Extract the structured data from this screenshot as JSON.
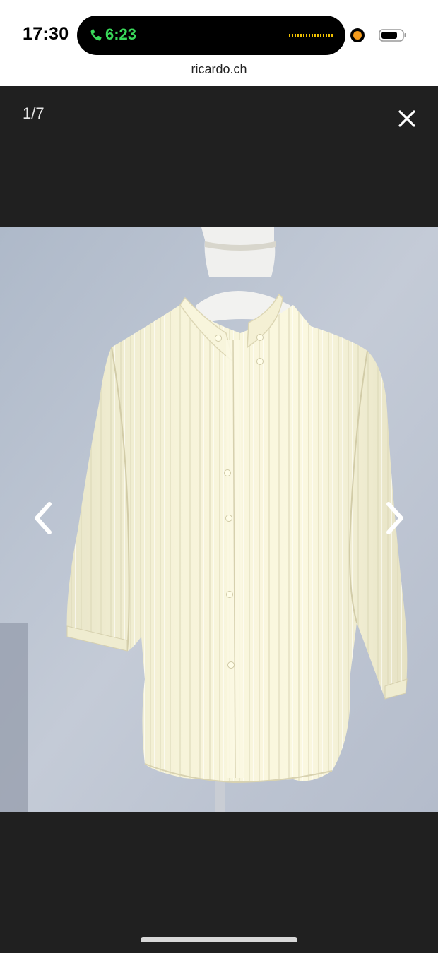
{
  "status_bar": {
    "time": "17:30",
    "call_time": "6:23",
    "call_icon": "phone-icon",
    "battery_icon": "battery-icon",
    "colors": {
      "call_green": "#39d95a",
      "privacy_dot": "#f49b1c"
    }
  },
  "browser": {
    "url": "ricardo.ch"
  },
  "viewer": {
    "counter": "1/7",
    "close_icon": "close-icon",
    "prev_icon": "chevron-left-icon",
    "next_icon": "chevron-right-icon",
    "photo_subject": "cream striped blouse on mannequin"
  }
}
